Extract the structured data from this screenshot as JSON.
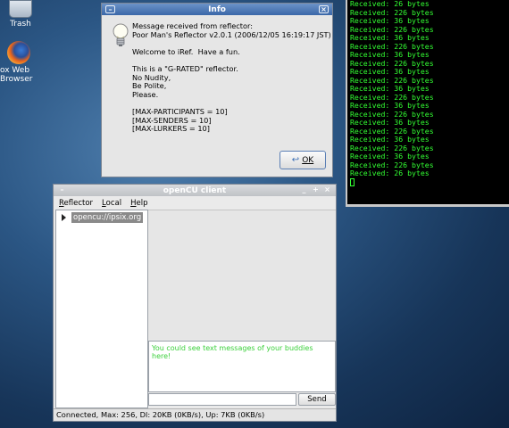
{
  "desktop": {
    "icons": [
      {
        "label": "Trash",
        "icon": "trash-icon"
      },
      {
        "label": "ox Web Browser",
        "icon": "firefox-icon"
      }
    ]
  },
  "terminal": {
    "text_color": "#33ff33",
    "lines": [
      "Received: 26 bytes",
      "Received: 226 bytes",
      "Received: 36 bytes",
      "Received: 226 bytes",
      "Received: 36 bytes",
      "Received: 226 bytes",
      "Received: 36 bytes",
      "Received: 226 bytes",
      "Received: 36 bytes",
      "Received: 226 bytes",
      "Received: 36 bytes",
      "Received: 226 bytes",
      "Received: 36 bytes",
      "Received: 226 bytes",
      "Received: 36 bytes",
      "Received: 226 bytes",
      "Received: 36 bytes",
      "Received: 226 bytes",
      "Received: 36 bytes",
      "Received: 226 bytes",
      "Received: 26 bytes"
    ]
  },
  "info_dialog": {
    "title": "Info",
    "icon": "lightbulb-icon",
    "message_lines": [
      "Message received from reflector:",
      "Poor Man's Reflector v2.0.1 (2006/12/05 16:19:17 JST)",
      "",
      "Welcome to iRef.  Have a fun.",
      "",
      "This is a \"G-RATED\" reflector.",
      "No Nudity,",
      "Be Polite,",
      "Please.",
      "",
      "[MAX-PARTICIPANTS = 10]",
      "[MAX-SENDERS = 10]",
      "[MAX-LURKERS = 10]"
    ],
    "ok_label": "OK"
  },
  "client": {
    "title": "openCU client",
    "title_buttons": [
      "_",
      "+",
      "×"
    ],
    "menus": [
      {
        "label": "Reflector",
        "mnemonic": "R",
        "rest": "eflector"
      },
      {
        "label": "Local",
        "mnemonic": "L",
        "rest": "ocal"
      },
      {
        "label": "Help",
        "mnemonic": "H",
        "rest": "elp"
      }
    ],
    "tree_node": "opencu://ipsix.org",
    "chat_text": "You could see text messages of your buddies here!",
    "chat_color": "#3ad03a",
    "input_value": "",
    "send_label": "Send",
    "status": "Connected, Max: 256, Dl: 20KB  (0KB/s), Up: 7KB  (0KB/s)"
  }
}
